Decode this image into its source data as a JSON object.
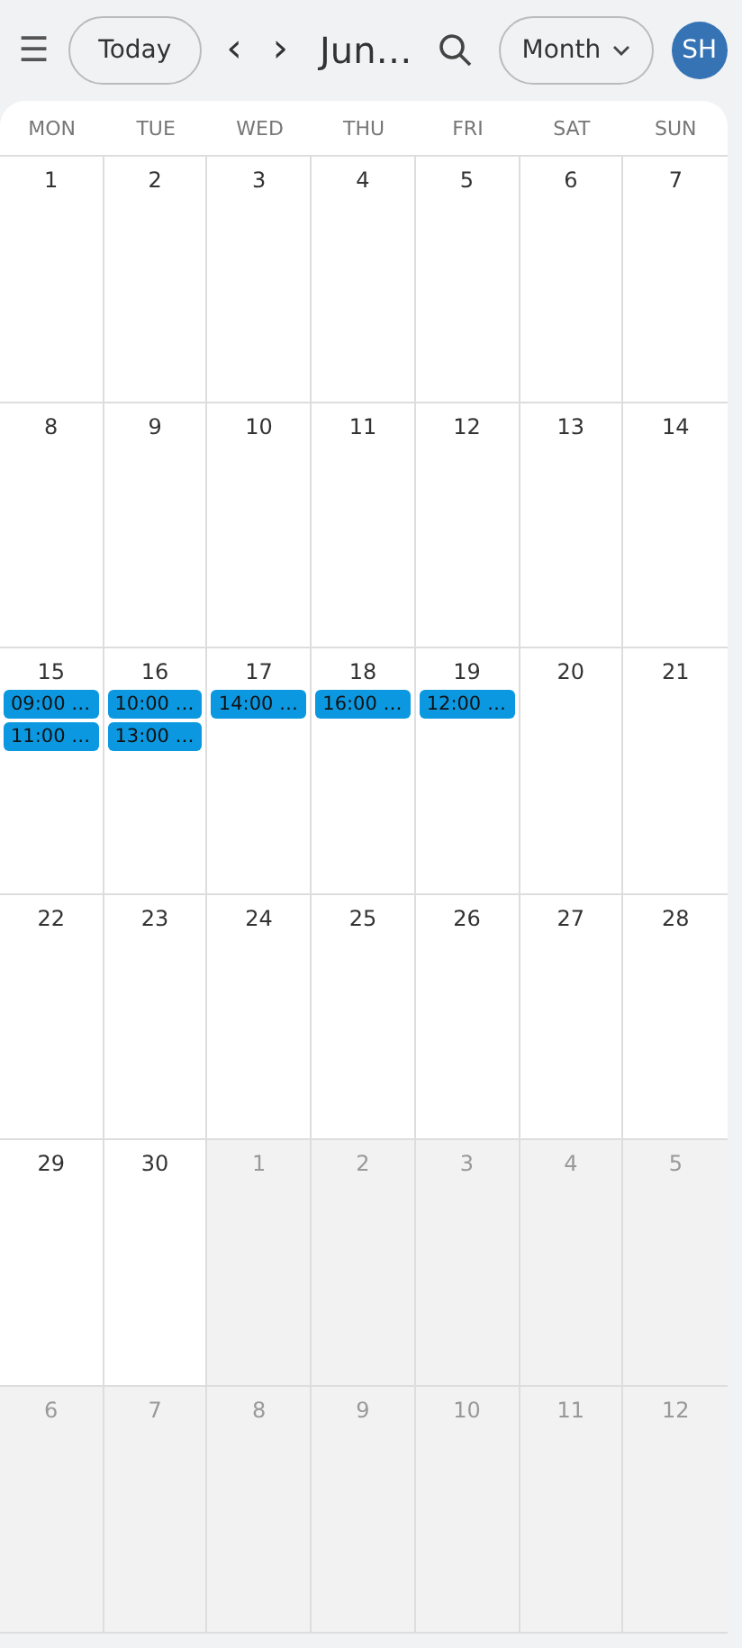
{
  "toolbar": {
    "menu_icon": "☰",
    "today_button": "Today",
    "prev": "‹",
    "next": "›",
    "title": "Jun…",
    "view_button": "Month",
    "avatar": "SH"
  },
  "weekdays": [
    "MON",
    "TUE",
    "WED",
    "THU",
    "FRI",
    "SAT",
    "SUN"
  ],
  "weeks": [
    [
      {
        "day": "1",
        "other_month": false
      },
      {
        "day": "2",
        "other_month": false
      },
      {
        "day": "3",
        "other_month": false
      },
      {
        "day": "4",
        "other_month": false
      },
      {
        "day": "5",
        "other_month": false
      },
      {
        "day": "6",
        "other_month": false
      },
      {
        "day": "7",
        "other_month": false
      }
    ],
    [
      {
        "day": "8",
        "other_month": false
      },
      {
        "day": "9",
        "other_month": false
      },
      {
        "day": "10",
        "other_month": false
      },
      {
        "day": "11",
        "other_month": false
      },
      {
        "day": "12",
        "other_month": false
      },
      {
        "day": "13",
        "other_month": false
      },
      {
        "day": "14",
        "other_month": false
      }
    ],
    [
      {
        "day": "15",
        "other_month": false,
        "events": [
          "09:00 …",
          "11:00 …"
        ]
      },
      {
        "day": "16",
        "other_month": false,
        "events": [
          "10:00 …",
          "13:00 …"
        ]
      },
      {
        "day": "17",
        "other_month": false,
        "events": [
          "14:00 …"
        ]
      },
      {
        "day": "18",
        "other_month": false,
        "events": [
          "16:00 …"
        ]
      },
      {
        "day": "19",
        "other_month": false,
        "events": [
          "12:00 …"
        ]
      },
      {
        "day": "20",
        "other_month": false
      },
      {
        "day": "21",
        "other_month": false
      }
    ],
    [
      {
        "day": "22",
        "other_month": false
      },
      {
        "day": "23",
        "other_month": false
      },
      {
        "day": "24",
        "other_month": false
      },
      {
        "day": "25",
        "other_month": false
      },
      {
        "day": "26",
        "other_month": false
      },
      {
        "day": "27",
        "other_month": false
      },
      {
        "day": "28",
        "other_month": false
      }
    ],
    [
      {
        "day": "29",
        "other_month": false
      },
      {
        "day": "30",
        "other_month": false
      },
      {
        "day": "1",
        "other_month": true
      },
      {
        "day": "2",
        "other_month": true
      },
      {
        "day": "3",
        "other_month": true
      },
      {
        "day": "4",
        "other_month": true
      },
      {
        "day": "5",
        "other_month": true
      }
    ],
    [
      {
        "day": "6",
        "other_month": true
      },
      {
        "day": "7",
        "other_month": true
      },
      {
        "day": "8",
        "other_month": true
      },
      {
        "day": "9",
        "other_month": true
      },
      {
        "day": "10",
        "other_month": true
      },
      {
        "day": "11",
        "other_month": true
      },
      {
        "day": "12",
        "other_month": true
      }
    ]
  ]
}
